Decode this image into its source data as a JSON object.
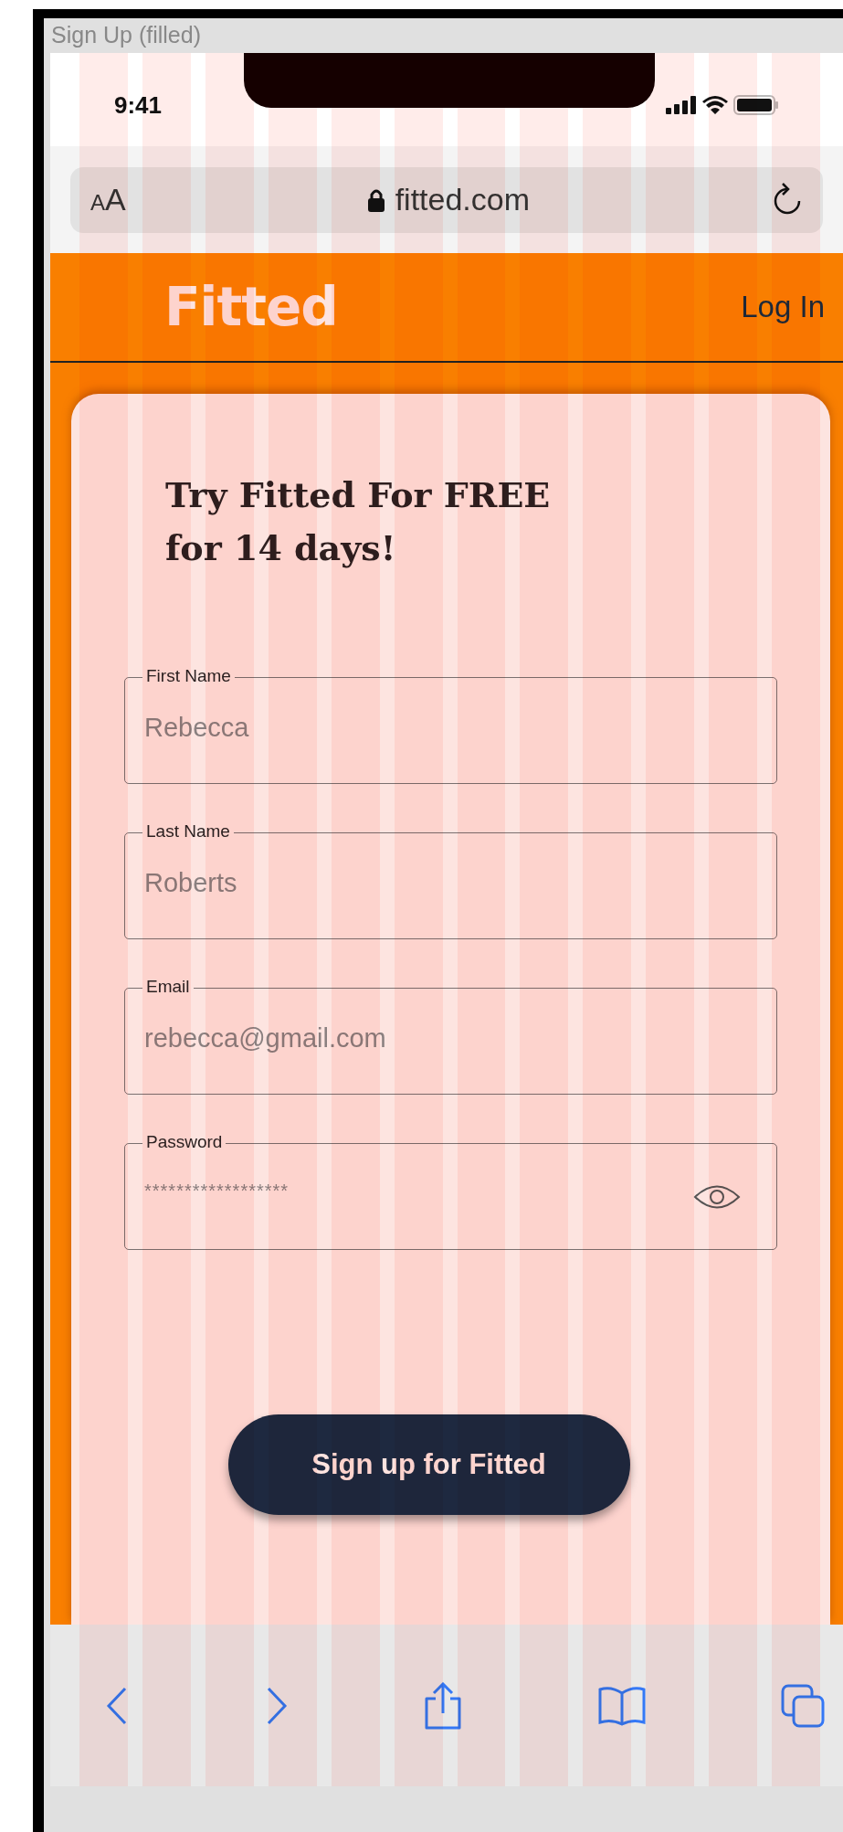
{
  "frame_title": "Sign Up (filled)",
  "status_bar": {
    "time": "9:41"
  },
  "browser": {
    "text_size": "AA",
    "url": "fitted.com"
  },
  "header": {
    "logo": "Fitted",
    "login": "Log In"
  },
  "heading": "Try Fitted For FREE for 14 days!",
  "fields": [
    {
      "kind": "text",
      "label": "First Name",
      "value": "Rebecca"
    },
    {
      "kind": "text",
      "label": "Last Name",
      "value": "Roberts"
    },
    {
      "kind": "text",
      "label": "Email",
      "value": "rebecca@gmail.com"
    },
    {
      "kind": "password",
      "label": "Password",
      "value": "******************"
    }
  ],
  "submit": "Sign up for Fitted"
}
